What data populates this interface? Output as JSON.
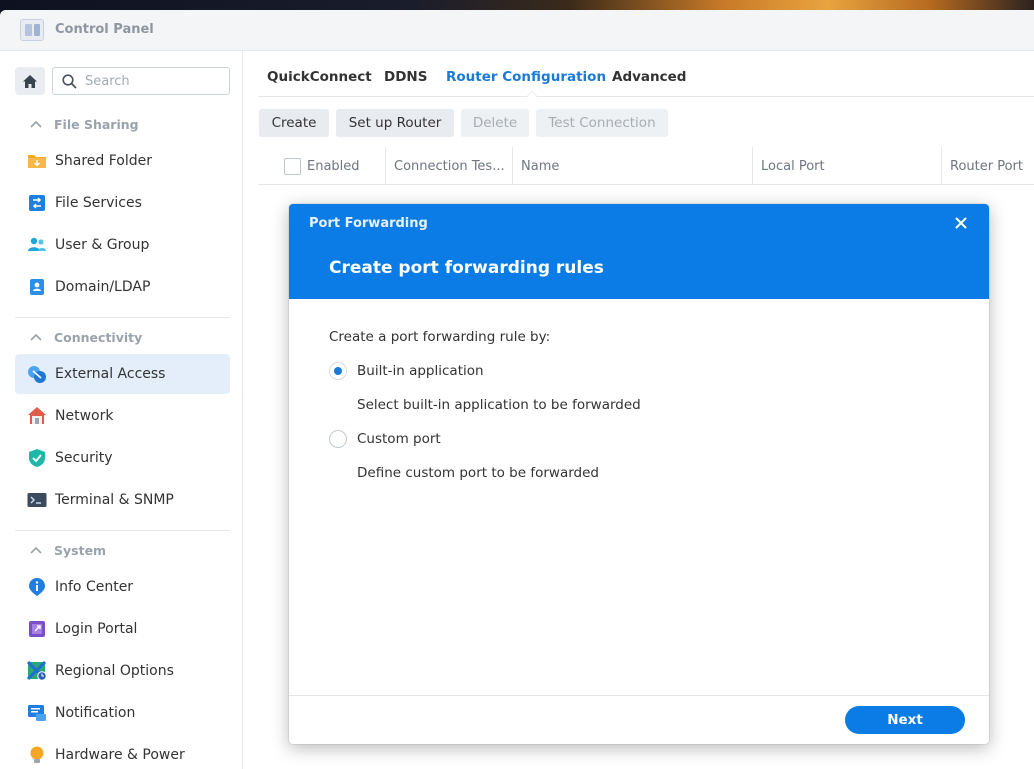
{
  "window": {
    "title": "Control Panel"
  },
  "sidebar": {
    "search": {
      "placeholder": "Search"
    },
    "sections": [
      {
        "label": "File Sharing"
      },
      {
        "label": "Connectivity"
      },
      {
        "label": "System"
      }
    ],
    "items": [
      {
        "label": "Shared Folder",
        "icon": "folder-icon"
      },
      {
        "label": "File Services",
        "icon": "file-services-icon"
      },
      {
        "label": "User & Group",
        "icon": "user-group-icon"
      },
      {
        "label": "Domain/LDAP",
        "icon": "domain-icon"
      },
      {
        "label": "External Access",
        "icon": "external-access-icon",
        "active": true
      },
      {
        "label": "Network",
        "icon": "network-house-icon"
      },
      {
        "label": "Security",
        "icon": "shield-icon"
      },
      {
        "label": "Terminal & SNMP",
        "icon": "terminal-icon"
      },
      {
        "label": "Info Center",
        "icon": "info-icon"
      },
      {
        "label": "Login Portal",
        "icon": "login-portal-icon"
      },
      {
        "label": "Regional Options",
        "icon": "regional-icon"
      },
      {
        "label": "Notification",
        "icon": "notification-icon"
      },
      {
        "label": "Hardware & Power",
        "icon": "bulb-icon"
      }
    ]
  },
  "main": {
    "tabs": [
      {
        "label": "QuickConnect"
      },
      {
        "label": "DDNS"
      },
      {
        "label": "Router Configuration",
        "active": true
      },
      {
        "label": "Advanced"
      }
    ],
    "toolbar": {
      "create": "Create",
      "setup_router": "Set up Router",
      "delete": "Delete",
      "test_connection": "Test Connection"
    },
    "columns": [
      "Enabled",
      "Connection Tes...",
      "Name",
      "Local Port",
      "Router Port"
    ]
  },
  "dialog": {
    "kicker": "Port Forwarding",
    "title": "Create port forwarding rules",
    "prompt": "Create a port forwarding rule by:",
    "options": [
      {
        "label": "Built-in application",
        "description": "Select built-in application to be forwarded",
        "selected": true
      },
      {
        "label": "Custom port",
        "description": "Define custom port to be forwarded",
        "selected": false
      }
    ],
    "next": "Next"
  },
  "colors": {
    "accent": "#0b7ce6",
    "active_tab": "#1a7ad6",
    "sidebar_active_bg": "#e4eefb"
  }
}
